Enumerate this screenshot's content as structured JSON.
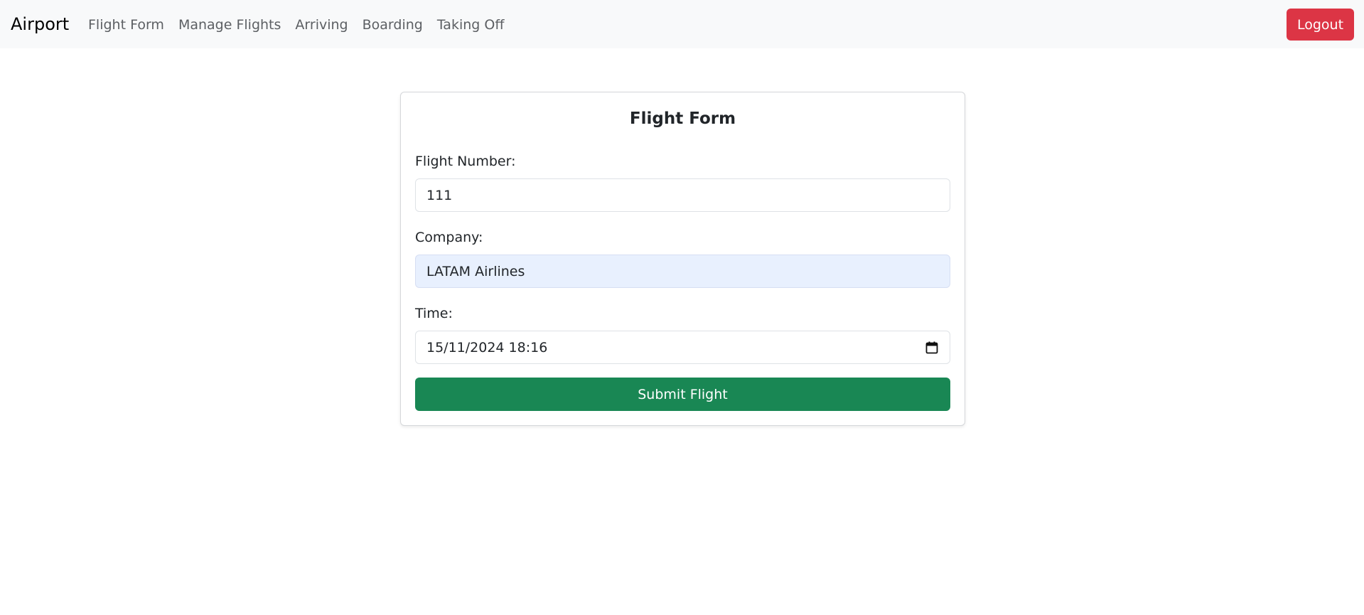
{
  "navbar": {
    "brand": "Airport",
    "links": [
      {
        "label": "Flight Form"
      },
      {
        "label": "Manage Flights"
      },
      {
        "label": "Arriving"
      },
      {
        "label": "Boarding"
      },
      {
        "label": "Taking Off"
      }
    ],
    "logout_label": "Logout"
  },
  "form": {
    "title": "Flight Form",
    "flight_number": {
      "label": "Flight Number:",
      "value": "111"
    },
    "company": {
      "label": "Company:",
      "value": "LATAM Airlines"
    },
    "time": {
      "label": "Time:",
      "value": "15/11/2024 18:16",
      "icon": "calendar-icon"
    },
    "submit_label": "Submit Flight"
  },
  "colors": {
    "navbar_bg": "#f8f9fa",
    "logout_bg": "#dc3545",
    "submit_bg": "#198754",
    "autofill_bg": "#e8f0fe"
  }
}
